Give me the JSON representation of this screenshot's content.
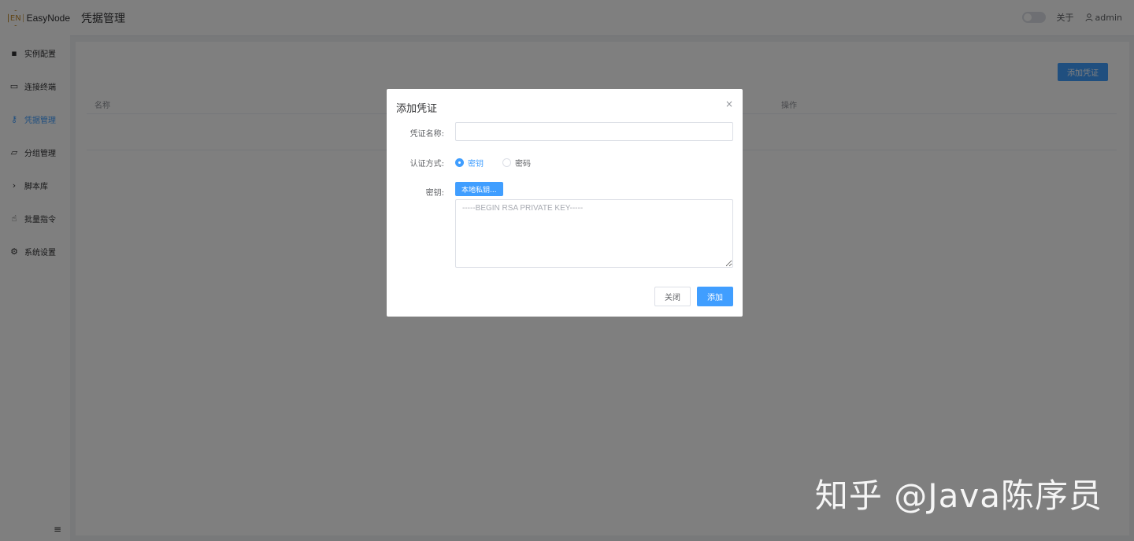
{
  "app": {
    "logo_mark": "EN",
    "name": "EasyNode"
  },
  "header": {
    "title": "凭据管理",
    "about_label": "关于",
    "user_name": "admin",
    "user_icon": "user-icon",
    "theme_toggle_on": false
  },
  "sidebar": {
    "items": [
      {
        "label": "实例配置",
        "icon": "grid-icon",
        "glyph": "▪"
      },
      {
        "label": "连接终端",
        "icon": "terminal-icon",
        "glyph": "▭"
      },
      {
        "label": "凭据管理",
        "icon": "key-icon",
        "glyph": "⚷",
        "active": true
      },
      {
        "label": "分组管理",
        "icon": "folder-icon",
        "glyph": "▱"
      },
      {
        "label": "脚本库",
        "icon": "chevron-right-icon",
        "glyph": "›"
      },
      {
        "label": "批量指令",
        "icon": "hand-icon",
        "glyph": "☝"
      },
      {
        "label": "系统设置",
        "icon": "gear-icon",
        "glyph": "⚙"
      }
    ],
    "collapse_glyph": "≡"
  },
  "main": {
    "add_button_label": "添加凭证",
    "table": {
      "columns": [
        "名称",
        "操作"
      ]
    }
  },
  "dialog": {
    "title": "添加凭证",
    "close_glyph": "×",
    "name_label": "凭证名称:",
    "name_value": "",
    "auth_label": "认证方式:",
    "auth_options": [
      "密钥",
      "密码"
    ],
    "auth_selected": "密钥",
    "key_label": "密钥:",
    "local_key_button": "本地私钥...",
    "key_placeholder": "-----BEGIN RSA PRIVATE KEY-----",
    "cancel_label": "关闭",
    "submit_label": "添加"
  },
  "watermark": "知乎 @Java陈序员",
  "colors": {
    "primary": "#409eff",
    "overlay": "rgba(0,0,0,0.5)"
  }
}
